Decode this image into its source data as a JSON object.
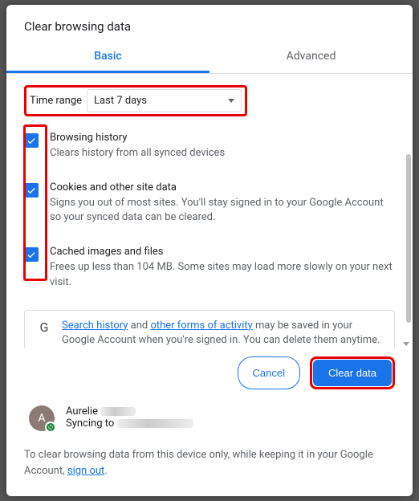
{
  "dialog": {
    "title": "Clear browsing data",
    "tabs": {
      "basic": "Basic",
      "advanced": "Advanced",
      "active": "basic"
    },
    "timerange": {
      "label": "Time range",
      "value": "Last 7 days"
    },
    "options": [
      {
        "title": "Browsing history",
        "desc": "Clears history from all synced devices"
      },
      {
        "title": "Cookies and other site data",
        "desc": "Signs you out of most sites. You'll stay signed in to your Google Account so your synced data can be cleared."
      },
      {
        "title": "Cached images and files",
        "desc": "Frees up less than 104 MB. Some sites may load more slowly on your next visit."
      }
    ],
    "info": {
      "link1": "Search history",
      "mid": " and ",
      "link2": "other forms of activity",
      "rest": " may be saved in your Google Account when you're signed in. You can delete them anytime."
    },
    "buttons": {
      "cancel": "Cancel",
      "primary": "Clear data"
    },
    "account": {
      "initial": "A",
      "name": "Aurelie",
      "sync_prefix": "Syncing to"
    },
    "footer": {
      "text_before": "To clear browsing data from this device only, while keeping it in your Google Account, ",
      "link": "sign out",
      "text_after": "."
    }
  }
}
